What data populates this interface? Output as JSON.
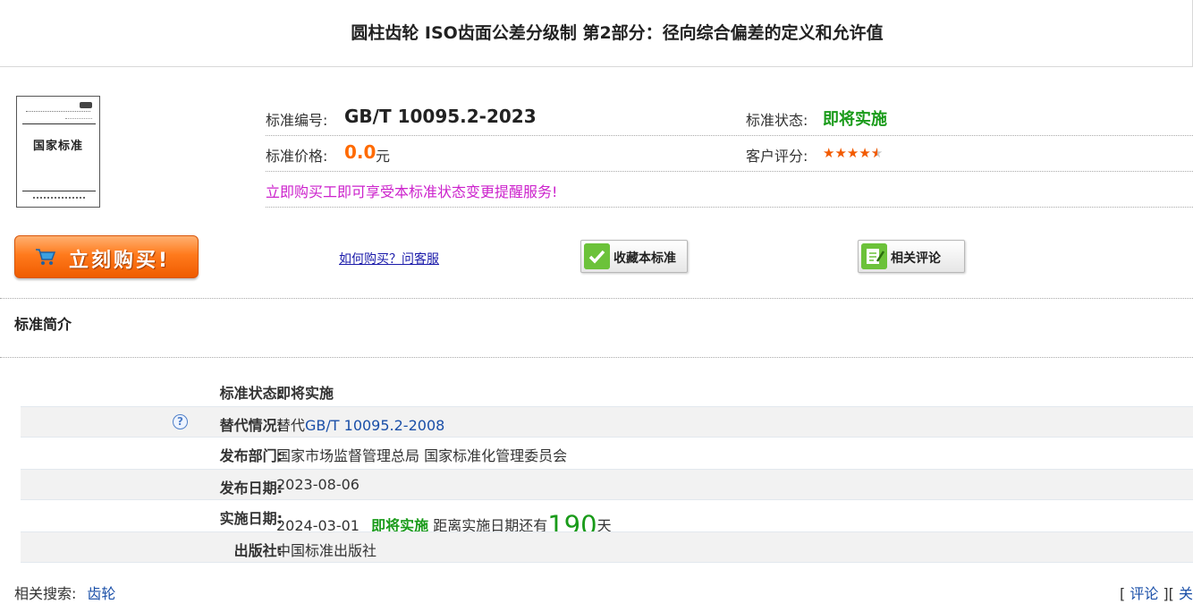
{
  "page_title": "圆柱齿轮 ISO齿面公差分级制 第2部分：径向综合偏差的定义和允许值",
  "cover": {
    "title": "国家标准"
  },
  "info": {
    "std_no_label": "标准编号:",
    "std_no": "GB/T 10095.2-2023",
    "status_label": "标准状态:",
    "status": "即将实施",
    "price_label": "标准价格:",
    "price": "0.0",
    "price_unit": "元",
    "rating_label": "客户评分:",
    "rating": 4.5,
    "promo": "立即购买工即可享受本标准状态变更提醒服务!"
  },
  "actions": {
    "buy": "立刻购买!",
    "howto": "如何购买？问客服",
    "favorite": "收藏本标准",
    "reviews": "相关评论"
  },
  "section_title": "标准简介",
  "details": {
    "status": {
      "label": "标准状态:",
      "value": "即将实施"
    },
    "replace": {
      "label": "替代情况:",
      "prefix": "替代",
      "link": "GB/T 10095.2-2008"
    },
    "dept": {
      "label": "发布部门:",
      "value": "国家市场监督管理总局 国家标准化管理委员会"
    },
    "pub_date": {
      "label": "发布日期:",
      "value": "2023-08-06"
    },
    "impl_date": {
      "label": "实施日期:",
      "value": "2024-03-01",
      "status": "即将实施",
      "countdown_prefix": "距离实施日期还有",
      "days": "190",
      "unit": "天"
    },
    "publisher": {
      "label": "出版社:",
      "value": "中国标准出版社"
    }
  },
  "related": {
    "label": "相关搜索:",
    "keyword": "齿轮"
  },
  "tools": {
    "review": "评论",
    "close": "关"
  },
  "colors": {
    "status_green": "#1a9b1a",
    "price_orange": "#ff6a00",
    "promo_magenta": "#cc22cc",
    "link_blue": "#1a4fa8"
  }
}
